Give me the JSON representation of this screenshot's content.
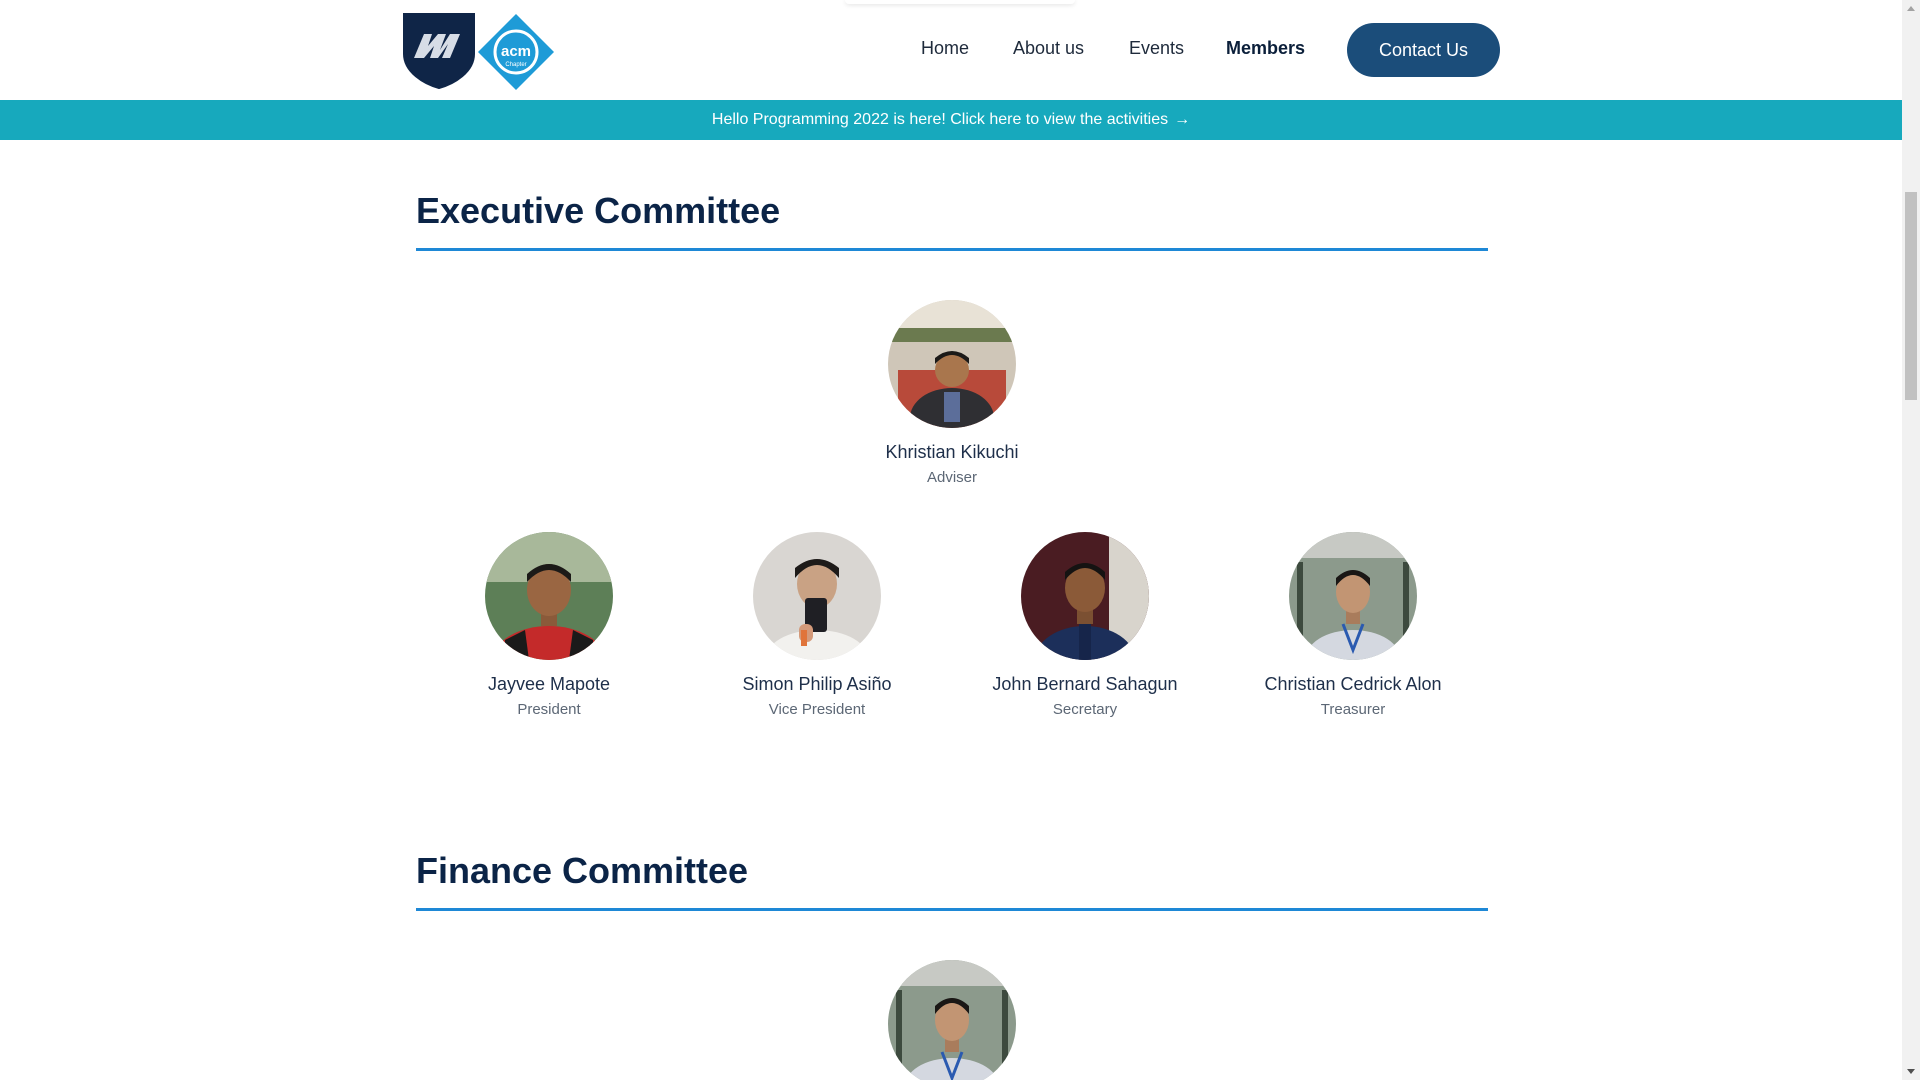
{
  "nav": {
    "items": [
      {
        "label": "Home"
      },
      {
        "label": "About us"
      },
      {
        "label": "Events"
      },
      {
        "label": "Members",
        "active": true
      }
    ],
    "contact_label": "Contact Us"
  },
  "logo": {
    "acm_text": "acm",
    "acm_subtext": "Chapter"
  },
  "announcement": {
    "text": "Hello Programming 2022 is here! Click here to view the activities",
    "icon": "arrow-right-icon"
  },
  "executive": {
    "title": "Executive Committee",
    "adviser": {
      "name": "Khristian Kikuchi",
      "role": "Adviser"
    },
    "officers": [
      {
        "name": "Jayvee Mapote",
        "role": "President"
      },
      {
        "name": "Simon Philip Asiño",
        "role": "Vice President"
      },
      {
        "name": "John Bernard Sahagun",
        "role": "Secretary"
      },
      {
        "name": "Christian Cedrick Alon",
        "role": "Treasurer"
      }
    ]
  },
  "finance": {
    "title": "Finance Committee"
  },
  "colors": {
    "brand_navy": "#0b2447",
    "button_blue": "#1b4d7a",
    "announce_teal": "#17a9bd",
    "rule_blue": "#1e88d6"
  }
}
